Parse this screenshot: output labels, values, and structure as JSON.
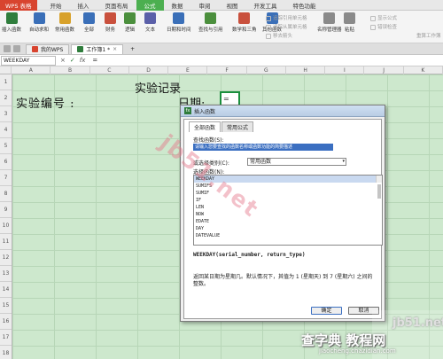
{
  "menubar": {
    "wps_button": "WPS 表格",
    "items": [
      "开始",
      "插入",
      "页面布局",
      "公式",
      "数据",
      "审阅",
      "视图",
      "开发工具",
      "特色功能"
    ],
    "active_index": 3
  },
  "ribbon": {
    "buttons": [
      {
        "label": "插入函数",
        "icon": "fx-icon",
        "color": "#2f7d3c"
      },
      {
        "label": "自动求和",
        "icon": "sum-icon",
        "color": "#3a6fb8"
      },
      {
        "label": "常用函数",
        "icon": "star-icon",
        "color": "#d8a12a"
      },
      {
        "label": "全部",
        "icon": "all-icon",
        "color": "#3a6fb8"
      },
      {
        "label": "财务",
        "icon": "finance-icon",
        "color": "#c9503d"
      },
      {
        "label": "逻辑",
        "icon": "logic-icon",
        "color": "#4b8f3d"
      },
      {
        "label": "文本",
        "icon": "text-icon",
        "color": "#5a5fa8"
      },
      {
        "label": "日期和时间",
        "icon": "clock-icon",
        "color": "#3a6fb8"
      },
      {
        "label": "查找与引用",
        "icon": "lookup-icon",
        "color": "#4b8f3d"
      },
      {
        "label": "数学和三角",
        "icon": "math-icon",
        "color": "#c9503d"
      },
      {
        "label": "其他函数",
        "icon": "more-icon",
        "color": "#3a6fb8"
      },
      {
        "label": "名称管理器",
        "icon": "names-icon",
        "color": "#8a8a8a"
      },
      {
        "label": "粘贴",
        "icon": "paste-icon",
        "color": "#8a8a8a"
      }
    ],
    "small": [
      "追踪引用单元格",
      "追踪从属单元格",
      "移去箭头",
      "显示公式",
      "错误检查"
    ],
    "right_label": "重算工作簿"
  },
  "tabs": {
    "items": [
      "我的WPS",
      "工作簿1 *"
    ],
    "close_glyph": "×",
    "add_glyph": "+"
  },
  "formula_bar": {
    "name_box": "WEEKDAY",
    "cancel_glyph": "×",
    "confirm_glyph": "✓",
    "fx_label": "fx",
    "content": "="
  },
  "sheet": {
    "columns": [
      "A",
      "B",
      "C",
      "D",
      "E",
      "F",
      "G",
      "H",
      "I",
      "J",
      "K"
    ],
    "rows": [
      "1",
      "2",
      "3",
      "4",
      "5",
      "6",
      "7",
      "8",
      "9",
      "10",
      "11",
      "12",
      "13",
      "14",
      "15",
      "16",
      "17",
      "18"
    ],
    "title": "实验记录",
    "label_id": "实验编号 :",
    "label_date": "日期:",
    "active_value": "="
  },
  "dialog": {
    "title": "插入函数",
    "tabs": [
      "全部函数",
      "常用公式"
    ],
    "search_label": "查找函数(S):",
    "search_value": "请输入您要查找的函数名称或函数功能的简要描述",
    "category_label": "或选择类别(C):",
    "category_value": "常用函数",
    "category_arrow": "▾",
    "list_label": "选择函数(N):",
    "functions": [
      "WEEKDAY",
      "SUMIFS",
      "SUMIF",
      "IF",
      "LEN",
      "NOW",
      "EDATE",
      "DAY",
      "DATEVALUE"
    ],
    "signature": "WEEKDAY(serial_number, return_type)",
    "description": "返回某日期为星期几。默认情况下，其值为 1 (星期天) 到 7 (星期六) 之间的整数。",
    "ok": "确定",
    "cancel": "取消"
  },
  "watermarks": {
    "diagonal": "jb51.net",
    "site_top": "jb51.net",
    "site_big": "查字典 教程网",
    "site_url": "jiaocheng.chazidian.com"
  }
}
